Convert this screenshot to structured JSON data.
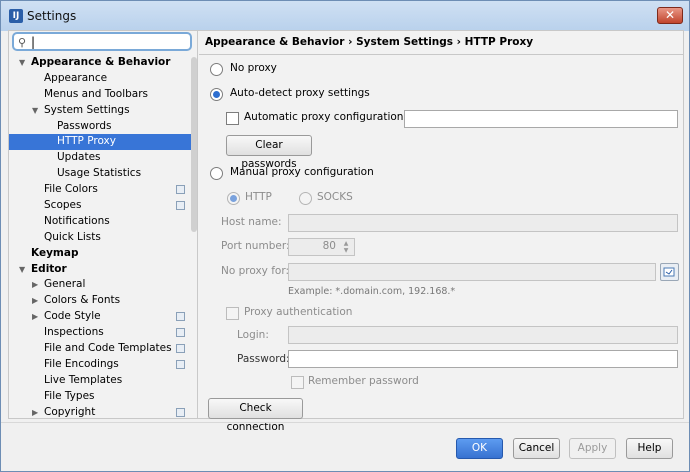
{
  "window": {
    "title": "Settings",
    "app_icon": "IJ"
  },
  "search": {
    "value": ""
  },
  "tree": [
    {
      "label": "Appearance & Behavior",
      "level": 0,
      "bold": true,
      "arrow": "down"
    },
    {
      "label": "Appearance",
      "level": 1
    },
    {
      "label": "Menus and Toolbars",
      "level": 1
    },
    {
      "label": "System Settings",
      "level": 1,
      "arrow": "down"
    },
    {
      "label": "Passwords",
      "level": 2
    },
    {
      "label": "HTTP Proxy",
      "level": 2,
      "selected": true
    },
    {
      "label": "Updates",
      "level": 2
    },
    {
      "label": "Usage Statistics",
      "level": 2
    },
    {
      "label": "File Colors",
      "level": 1,
      "icon": true
    },
    {
      "label": "Scopes",
      "level": 1,
      "icon": true
    },
    {
      "label": "Notifications",
      "level": 1
    },
    {
      "label": "Quick Lists",
      "level": 1
    },
    {
      "label": "Keymap",
      "level": 0,
      "bold": true
    },
    {
      "label": "Editor",
      "level": 0,
      "bold": true,
      "arrow": "down"
    },
    {
      "label": "General",
      "level": 1,
      "arrow": "right"
    },
    {
      "label": "Colors & Fonts",
      "level": 1,
      "arrow": "right"
    },
    {
      "label": "Code Style",
      "level": 1,
      "arrow": "right",
      "icon": true
    },
    {
      "label": "Inspections",
      "level": 1,
      "icon": true
    },
    {
      "label": "File and Code Templates",
      "level": 1,
      "icon": true
    },
    {
      "label": "File Encodings",
      "level": 1,
      "icon": true
    },
    {
      "label": "Live Templates",
      "level": 1
    },
    {
      "label": "File Types",
      "level": 1
    },
    {
      "label": "Copyright",
      "level": 1,
      "arrow": "right",
      "icon": true
    }
  ],
  "breadcrumb": "Appearance & Behavior › System Settings › HTTP Proxy",
  "proxy": {
    "no_proxy": "No proxy",
    "auto_detect": "Auto-detect proxy settings",
    "auto_config_url": "Automatic proxy configuration URL:",
    "auto_config_url_value": "",
    "clear_passwords": "Clear passwords",
    "manual": "Manual proxy configuration",
    "http": "HTTP",
    "socks": "SOCKS",
    "host_name": "Host name:",
    "host_value": "",
    "port_number": "Port number:",
    "port_value": "80",
    "no_proxy_for": "No proxy for:",
    "no_proxy_value": "",
    "example": "Example: *.domain.com, 192.168.*",
    "proxy_auth": "Proxy authentication",
    "login": "Login:",
    "login_value": "",
    "password": "Password:",
    "password_value": "",
    "remember_password": "Remember password",
    "check_connection": "Check connection",
    "selected_mode": "auto_detect"
  },
  "footer": {
    "ok": "OK",
    "cancel": "Cancel",
    "apply": "Apply",
    "help": "Help"
  },
  "colors": {
    "selection": "#3875d7",
    "primary_button": "#3772d1"
  }
}
